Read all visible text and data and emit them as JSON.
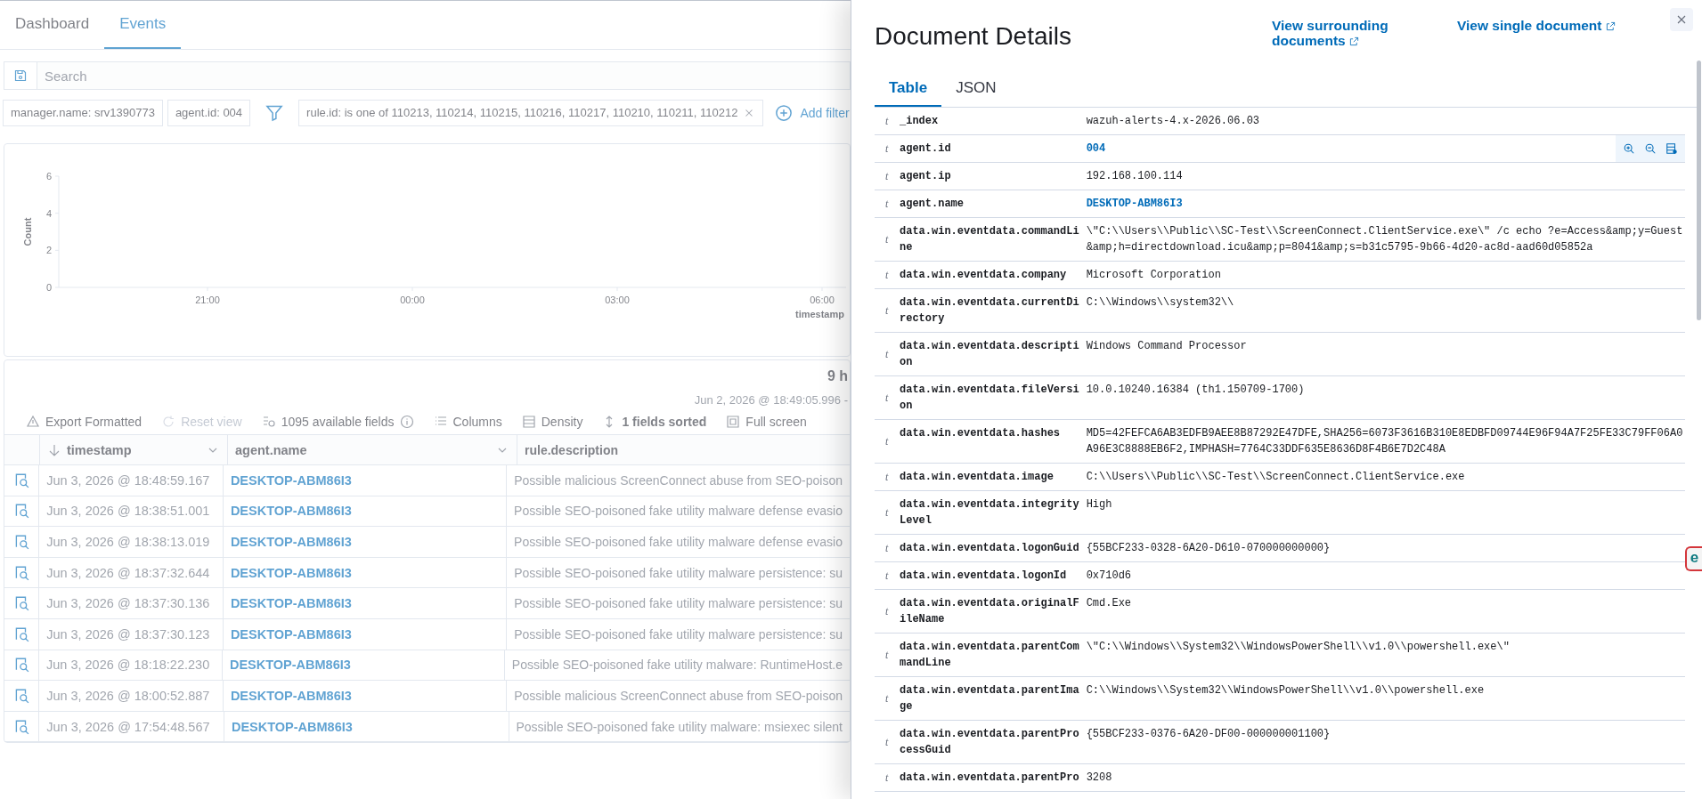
{
  "background_page": {
    "tabs": [
      {
        "label": "Dashboard",
        "selected": false
      },
      {
        "label": "Events",
        "selected": true
      }
    ],
    "search": {
      "placeholder": "Search"
    },
    "pinned_filters": [
      "manager.name: srv1390773",
      "agent.id: 004"
    ],
    "filters": [
      "rule.id: is one of 110213, 110214, 110215, 110216, 110217, 110210, 110211, 110212"
    ],
    "add_filter": "Add filter",
    "chart": {
      "chart_data": {
        "type": "bar",
        "ylabel": "Count",
        "xlabel": "timestamp",
        "ylim": [
          0,
          6
        ],
        "yticks": [
          0,
          2,
          4,
          6
        ],
        "categories": [
          "21:00",
          "00:00",
          "03:00",
          "06:00"
        ]
      }
    },
    "hits": {
      "count": "9 h",
      "range": "Jun 2, 2026 @ 18:49:05.996 -"
    },
    "toolbar": [
      {
        "kind": "export",
        "label": "Export Formatted",
        "disabled": false,
        "emphasis": false
      },
      {
        "kind": "reset",
        "label": "Reset view",
        "disabled": true,
        "emphasis": false
      },
      {
        "kind": "fields",
        "label": "1095 available fields",
        "disabled": false,
        "emphasis": false
      },
      {
        "kind": "columns",
        "label": "Columns",
        "disabled": false,
        "emphasis": false
      },
      {
        "kind": "density",
        "label": "Density",
        "disabled": false,
        "emphasis": false
      },
      {
        "kind": "sort",
        "label": "1 fields sorted",
        "disabled": false,
        "emphasis": true
      },
      {
        "kind": "fullscreen",
        "label": "Full screen",
        "disabled": false,
        "emphasis": false
      }
    ],
    "table": {
      "columns": [
        {
          "label": "timestamp",
          "sorted": true,
          "menu": true
        },
        {
          "label": "agent.name",
          "sorted": false,
          "menu": true
        },
        {
          "label": "rule.description",
          "sorted": false,
          "menu": false
        }
      ],
      "rows": [
        {
          "timestamp": "Jun 3, 2026 @ 18:48:59.167",
          "agent": "DESKTOP-ABM86I3",
          "description": "Possible malicious ScreenConnect abuse from SEO-poison"
        },
        {
          "timestamp": "Jun 3, 2026 @ 18:38:51.001",
          "agent": "DESKTOP-ABM86I3",
          "description": "Possible SEO-poisoned fake utility malware defense evasio"
        },
        {
          "timestamp": "Jun 3, 2026 @ 18:38:13.019",
          "agent": "DESKTOP-ABM86I3",
          "description": "Possible SEO-poisoned fake utility malware defense evasio"
        },
        {
          "timestamp": "Jun 3, 2026 @ 18:37:32.644",
          "agent": "DESKTOP-ABM86I3",
          "description": "Possible SEO-poisoned fake utility malware persistence: su"
        },
        {
          "timestamp": "Jun 3, 2026 @ 18:37:30.136",
          "agent": "DESKTOP-ABM86I3",
          "description": "Possible SEO-poisoned fake utility malware persistence: su"
        },
        {
          "timestamp": "Jun 3, 2026 @ 18:37:30.123",
          "agent": "DESKTOP-ABM86I3",
          "description": "Possible SEO-poisoned fake utility malware persistence: su"
        },
        {
          "timestamp": "Jun 3, 2026 @ 18:18:22.230",
          "agent": "DESKTOP-ABM86I3",
          "description": "Possible SEO-poisoned fake utility malware: RuntimeHost.e"
        },
        {
          "timestamp": "Jun 3, 2026 @ 18:00:52.887",
          "agent": "DESKTOP-ABM86I3",
          "description": "Possible malicious ScreenConnect abuse from SEO-poison"
        },
        {
          "timestamp": "Jun 3, 2026 @ 17:54:48.567",
          "agent": "DESKTOP-ABM86I3",
          "description": "Possible SEO-poisoned fake utility malware: msiexec silent"
        }
      ]
    }
  },
  "flyout": {
    "title": "Document Details",
    "links": [
      "View surrounding documents",
      "View single document"
    ],
    "tabs": [
      {
        "label": "Table",
        "selected": true
      },
      {
        "label": "JSON",
        "selected": false
      }
    ],
    "fields": [
      {
        "type": "t",
        "name": "_index",
        "value": "wazuh-alerts-4.x-2026.06.03",
        "link": false,
        "hovered": false
      },
      {
        "type": "t",
        "name": "agent.id",
        "value": "004",
        "link": true,
        "hovered": true
      },
      {
        "type": "t",
        "name": "agent.ip",
        "value": "192.168.100.114",
        "link": false,
        "hovered": false
      },
      {
        "type": "t",
        "name": "agent.name",
        "value": "DESKTOP-ABM86I3",
        "link": true,
        "hovered": false
      },
      {
        "type": "t",
        "name": "data.win.eventdata.commandLine",
        "value": "\\\"C:\\\\Users\\\\Public\\\\SC-Test\\\\ScreenConnect.ClientService.exe\\\" /c echo ?e=Access&amp;y=Guest&amp;h=directdownload.icu&amp;p=8041&amp;s=b31c5795-9b66-4d20-ac8d-aad60d05852a",
        "link": false,
        "hovered": false
      },
      {
        "type": "t",
        "name": "data.win.eventdata.company",
        "value": "Microsoft Corporation",
        "link": false,
        "hovered": false
      },
      {
        "type": "t",
        "name": "data.win.eventdata.currentDirectory",
        "value": "C:\\\\Windows\\\\system32\\\\",
        "link": false,
        "hovered": false
      },
      {
        "type": "t",
        "name": "data.win.eventdata.description",
        "value": "Windows Command Processor",
        "link": false,
        "hovered": false
      },
      {
        "type": "t",
        "name": "data.win.eventdata.fileVersion",
        "value": "10.0.10240.16384 (th1.150709-1700)",
        "link": false,
        "hovered": false
      },
      {
        "type": "t",
        "name": "data.win.eventdata.hashes",
        "value": "MD5=42FEFCA6AB3EDFB9AEE8B87292E47DFE,SHA256=6073F3616B310E8EDBFD09744E96F94A7F25FE33C79FF06A0A96E3C8888EB6F2,IMPHASH=7764C33DDF635E8636D8F4B6E7D2C48A",
        "link": false,
        "hovered": false
      },
      {
        "type": "t",
        "name": "data.win.eventdata.image",
        "value": "C:\\\\Users\\\\Public\\\\SC-Test\\\\ScreenConnect.ClientService.exe",
        "link": false,
        "hovered": false
      },
      {
        "type": "t",
        "name": "data.win.eventdata.integrityLevel",
        "value": "High",
        "link": false,
        "hovered": false
      },
      {
        "type": "t",
        "name": "data.win.eventdata.logonGuid",
        "value": "{55BCF233-0328-6A20-D610-070000000000}",
        "link": false,
        "hovered": false
      },
      {
        "type": "t",
        "name": "data.win.eventdata.logonId",
        "value": "0x710d6",
        "link": false,
        "hovered": false
      },
      {
        "type": "t",
        "name": "data.win.eventdata.originalFileName",
        "value": "Cmd.Exe",
        "link": false,
        "hovered": false
      },
      {
        "type": "t",
        "name": "data.win.eventdata.parentCommandLine",
        "value": "\\\"C:\\\\Windows\\\\System32\\\\WindowsPowerShell\\\\v1.0\\\\powershell.exe\\\"",
        "link": false,
        "hovered": false
      },
      {
        "type": "t",
        "name": "data.win.eventdata.parentImage",
        "value": "C:\\\\Windows\\\\System32\\\\WindowsPowerShell\\\\v1.0\\\\powershell.exe",
        "link": false,
        "hovered": false
      },
      {
        "type": "t",
        "name": "data.win.eventdata.parentProcessGuid",
        "value": "{55BCF233-0376-6A20-DF00-000000001100}",
        "link": false,
        "hovered": false
      },
      {
        "type": "t",
        "name": "data.win.eventdata.parentPro",
        "value": "3208",
        "link": false,
        "hovered": false
      }
    ],
    "side_badge": "e"
  }
}
